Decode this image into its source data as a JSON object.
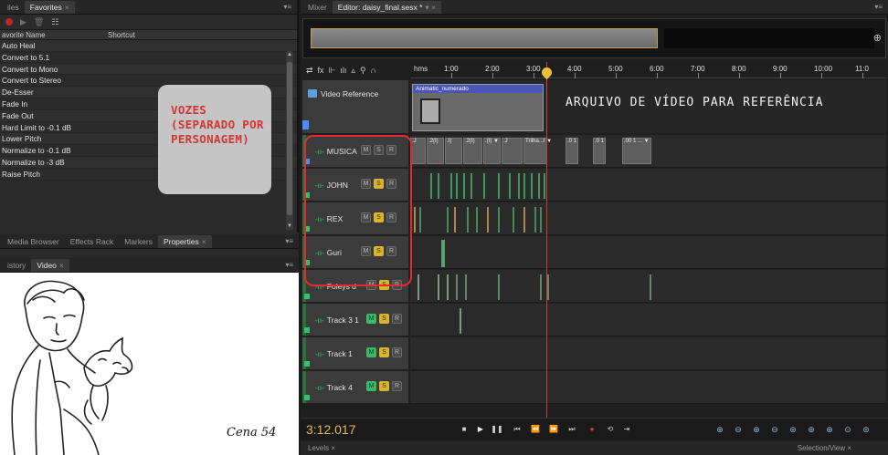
{
  "left_tabs": {
    "files": "iles",
    "favorites": "Favorites",
    "close": "×",
    "menu": "▾≡"
  },
  "favorites": {
    "header_name": "avorite Name",
    "header_shortcut": "Shortcut",
    "items": [
      "Auto Heal",
      "Convert to 5.1",
      "Convert to Mono",
      "Convert to Stereo",
      "De-Esser",
      "Fade In",
      "Fade Out",
      "Hard Limit to -0.1 dB",
      "Lower Pitch",
      "Normalize to -0.1 dB",
      "Normalize to -3 dB",
      "Raise Pitch"
    ]
  },
  "note": {
    "lines": [
      "VOZES",
      "(SEPARADO POR",
      "PERSONAGEM)"
    ],
    "color": "#d43434"
  },
  "panel_tabs": {
    "media_browser": "Media Browser",
    "effects_rack": "Effects Rack",
    "markers": "Markers",
    "properties": "Properties",
    "history": "istory",
    "video": "Video"
  },
  "video_preview": {
    "caption": "Cena 54"
  },
  "right_tabs": {
    "mixer": "Mixer",
    "editor": "Editor: daisy_final.sesx *"
  },
  "ruler": {
    "unit": "hms",
    "ticks": [
      "1:00",
      "2:00",
      "3:00",
      "4:00",
      "5:00",
      "6:00",
      "7:00",
      "8:00",
      "9:00",
      "10:00",
      "11:0"
    ]
  },
  "video_track": {
    "name": "Video Reference",
    "clip_title": "Animatic_numerado",
    "annotation": "ARQUIVO DE VÍDEO PARA REFERÊNCIA"
  },
  "tracks": [
    {
      "name": "MUSICA",
      "m": "M",
      "s": "S",
      "r": "R"
    },
    {
      "name": "JOHN",
      "m": "M",
      "s": "S",
      "r": "R"
    },
    {
      "name": "REX",
      "m": "M",
      "s": "S",
      "r": "R"
    },
    {
      "name": "Guri",
      "m": "M",
      "s": "S",
      "r": "R"
    },
    {
      "name": "Foleys d",
      "m": "M",
      "s": "S",
      "r": "R"
    },
    {
      "name": "Track 3 1",
      "m": "M",
      "s": "S",
      "r": "R"
    },
    {
      "name": "Track 1",
      "m": "M",
      "s": "S",
      "r": "R"
    },
    {
      "name": "Track 4",
      "m": "M",
      "s": "S",
      "r": "R"
    }
  ],
  "musica_clip_labels": [
    ".J",
    ".2(I)",
    ".I)",
    ".2(I)",
    ".(I) ▼",
    ".J",
    "Trilha...I ▼",
    ".0 1",
    ".0 1",
    ".00 1 ... ▼"
  ],
  "transport": {
    "timecode": "3:12.017"
  },
  "bottom": {
    "left": "Levels ×",
    "right": "Selection/View ×"
  }
}
